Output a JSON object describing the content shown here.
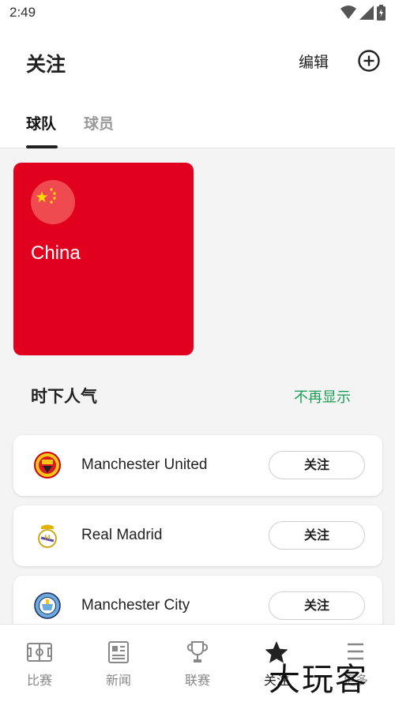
{
  "status_bar": {
    "time": "2:49"
  },
  "header": {
    "title": "关注",
    "edit_label": "编辑"
  },
  "tabs": [
    {
      "label": "球队",
      "active": true
    },
    {
      "label": "球员",
      "active": false
    }
  ],
  "followed_team": {
    "name": "China",
    "color": "#e2001f"
  },
  "popular": {
    "title": "时下人气",
    "dismiss_label": "不再显示",
    "clubs": [
      {
        "name": "Manchester United",
        "logo": "manchester-united-crest",
        "follow_label": "关注"
      },
      {
        "name": "Real Madrid",
        "logo": "real-madrid-crest",
        "follow_label": "关注"
      },
      {
        "name": "Manchester City",
        "logo": "manchester-city-crest",
        "follow_label": "关注"
      }
    ]
  },
  "bottom_nav": [
    {
      "label": "比赛",
      "icon": "pitch-icon"
    },
    {
      "label": "新闻",
      "icon": "news-icon"
    },
    {
      "label": "联赛",
      "icon": "trophy-icon"
    },
    {
      "label": "关注",
      "icon": "star-icon",
      "active": true
    },
    {
      "label": "更多",
      "icon": "menu-icon"
    }
  ],
  "watermark": "大玩客"
}
